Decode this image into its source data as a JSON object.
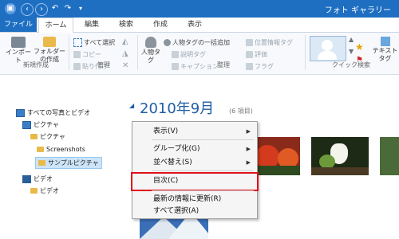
{
  "window": {
    "title": "フォト ギャラリー"
  },
  "tabs": [
    {
      "label": "ファイル"
    },
    {
      "label": "ホーム"
    },
    {
      "label": "編集"
    },
    {
      "label": "検索"
    },
    {
      "label": "作成"
    },
    {
      "label": "表示"
    }
  ],
  "ribbon": {
    "new_group": {
      "label": "新規作成",
      "import_label": "インポート",
      "new_folder_label": "フォルダーの作成"
    },
    "manage_group": {
      "label": "管理",
      "select_all": "すべて選択",
      "copy": "コピー",
      "paste": "貼り付け"
    },
    "organize_group": {
      "label": "整理",
      "people_tag": "人物タグ",
      "people_tag_bulk": "人物タグの一括追加",
      "caption_tag": "説明タグ",
      "caption": "キャプション",
      "geotag": "位置情報タグ",
      "rating": "評価",
      "flag": "フラグ"
    },
    "quick_find": {
      "label": "クイック検索"
    },
    "text_tag": "テキストタグ"
  },
  "nav": {
    "items": [
      {
        "label": "すべての写真とビデオ"
      },
      {
        "label": "ピクチャ"
      },
      {
        "label": "ピクチャ"
      },
      {
        "label": "Screenshots"
      },
      {
        "label": "サンプルピクチャ"
      },
      {
        "label": "ビデオ"
      },
      {
        "label": "ビデオ"
      }
    ]
  },
  "main": {
    "date_heading": "2010年9月",
    "item_count": "(6 項目)"
  },
  "context_menu": {
    "items": [
      {
        "label": "表示(V)",
        "submenu": true
      },
      {
        "label": "グループ化(G)",
        "submenu": true
      },
      {
        "label": "並べ替え(S)",
        "submenu": true
      },
      {
        "label": "目次(C)",
        "submenu": false,
        "highlighted": true
      },
      {
        "label": "最新の情報に更新(R)",
        "submenu": false
      },
      {
        "label": "すべて選択(A)",
        "submenu": false
      }
    ]
  },
  "colors": {
    "title_bar": "#1e6fc2",
    "heading": "#1f5da8",
    "highlight_box": "#e0101a",
    "nav_selection": "#cce4f7"
  }
}
